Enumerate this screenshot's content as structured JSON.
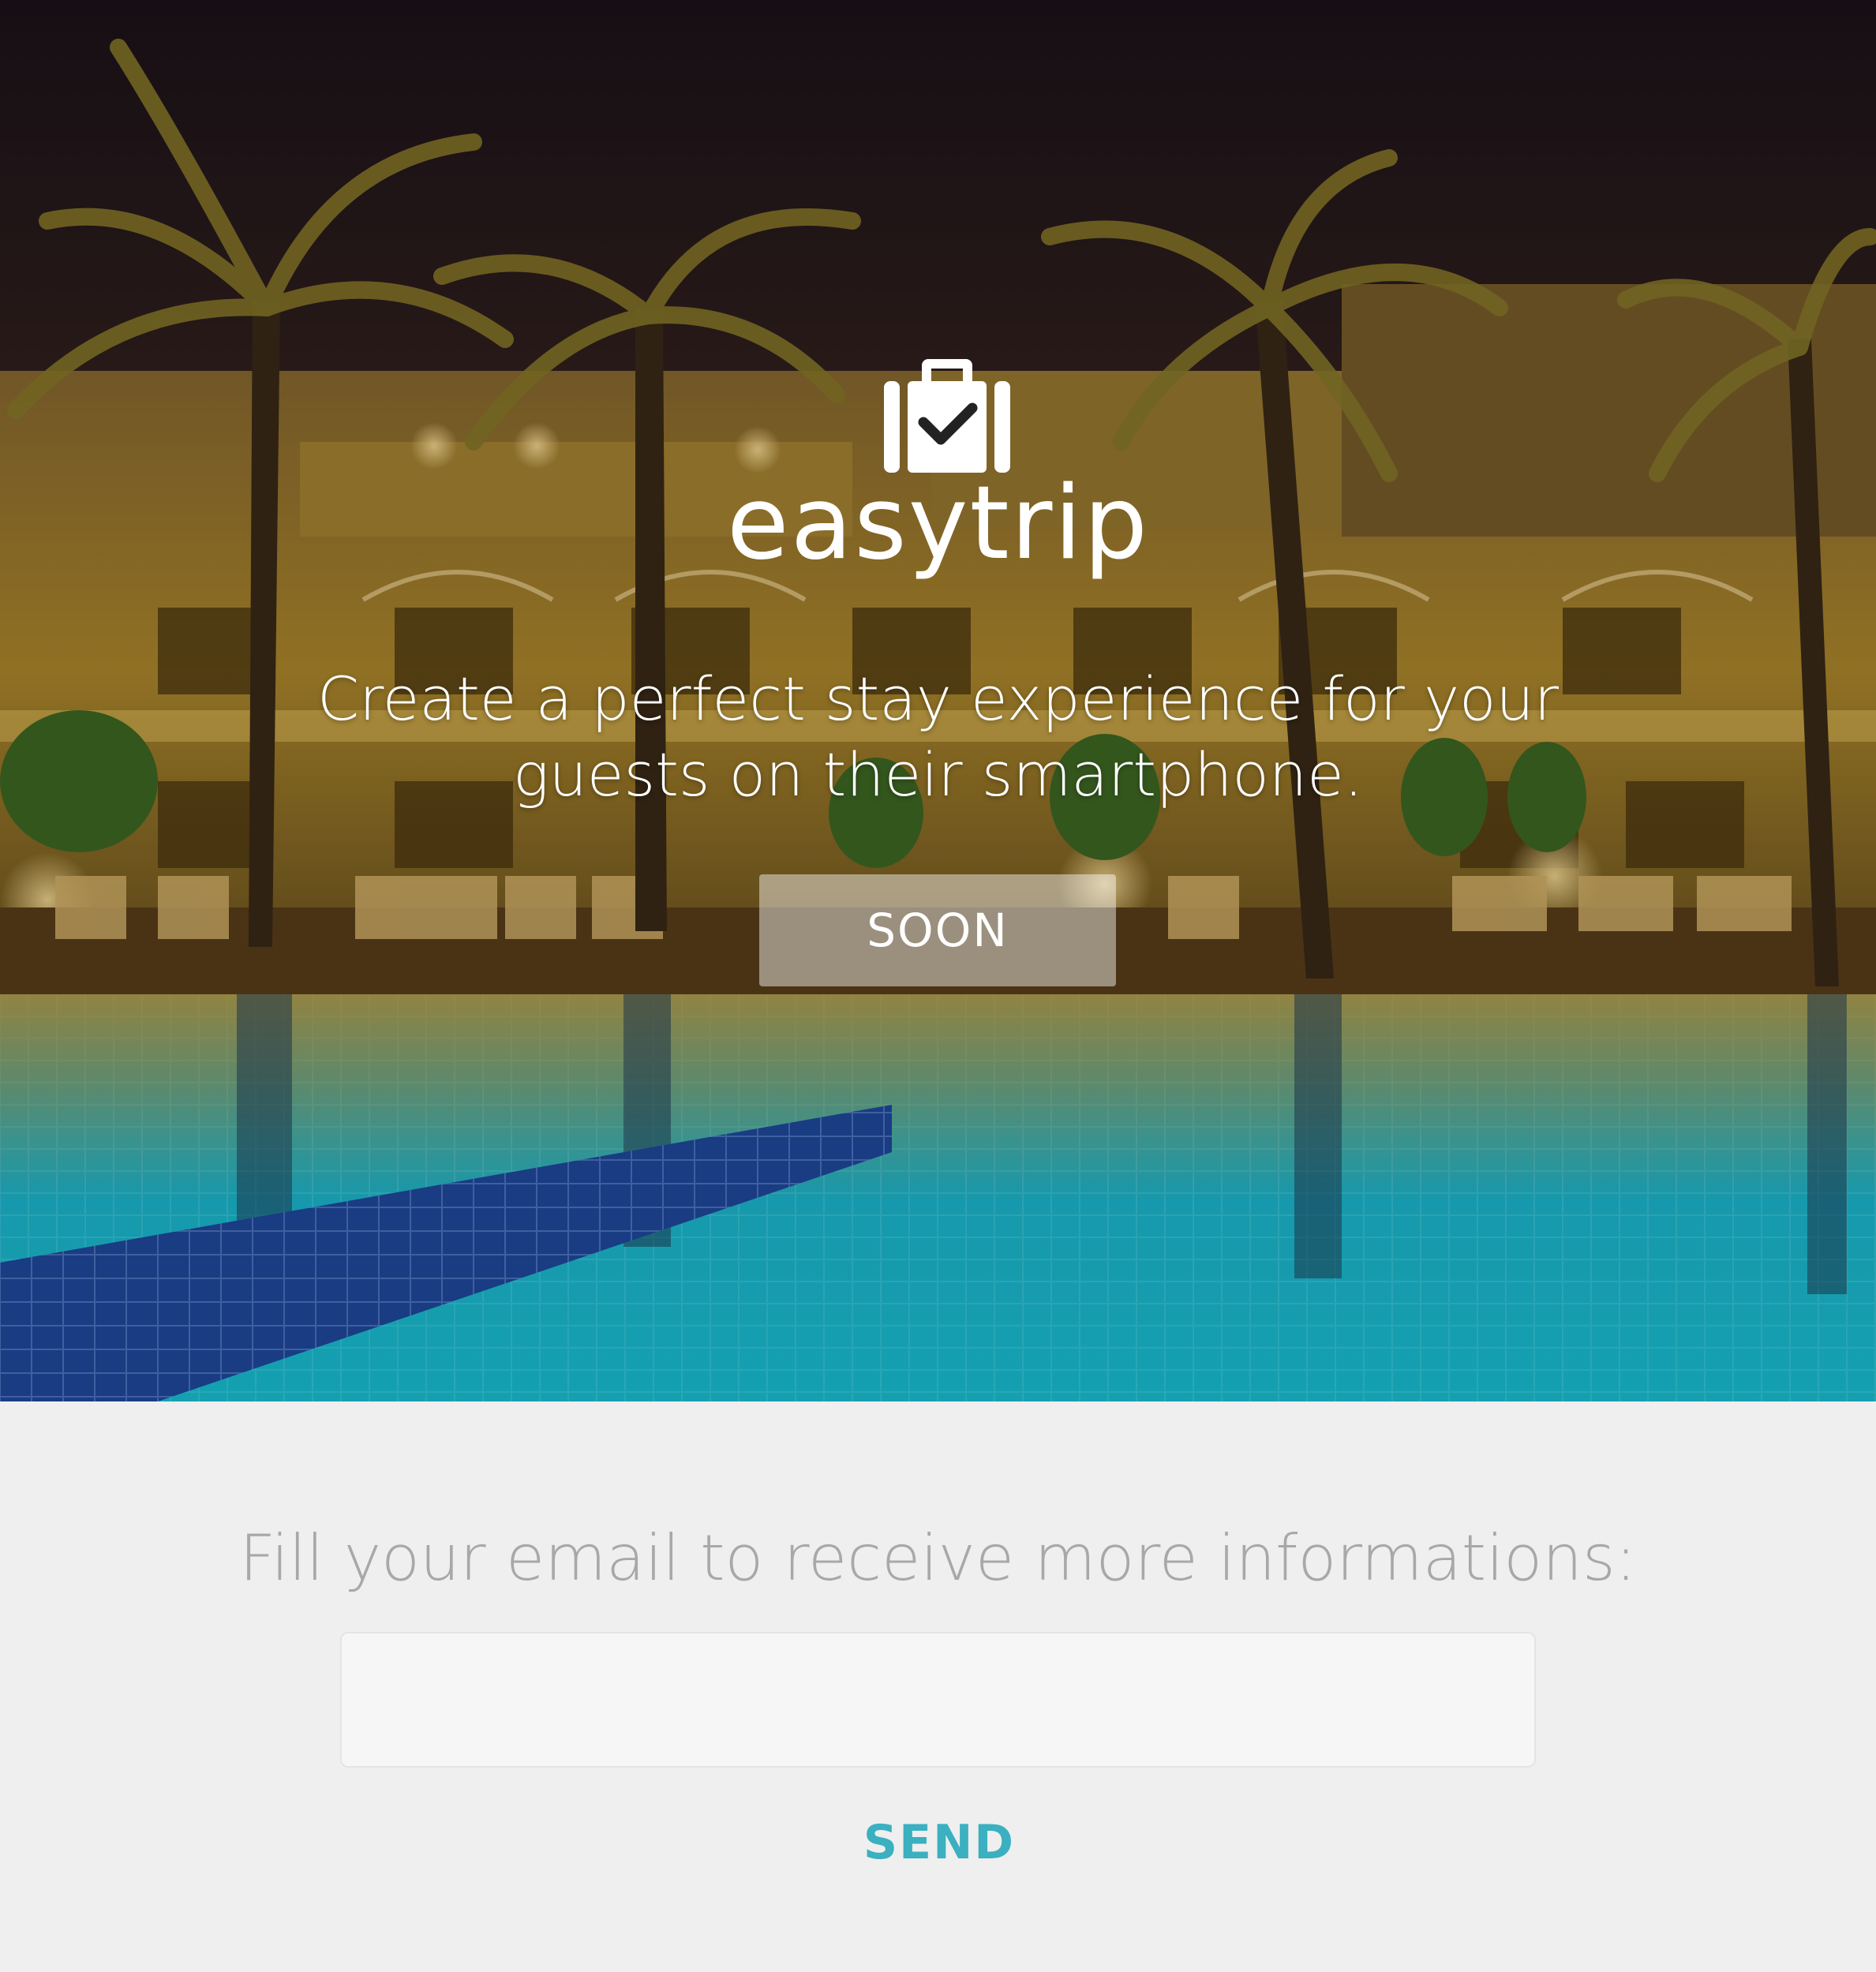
{
  "hero": {
    "brand_name": "easytrip",
    "tagline_line1": "Create a perfect stay experience for your",
    "tagline_line2": "guests on their smartphone.",
    "soon_label": "SOON",
    "logo_icon": "suitcase-check-icon",
    "background": "night-resort-pool-photo"
  },
  "signup": {
    "prompt": "Fill your email to receive more informations:",
    "email_value": "",
    "email_placeholder": "",
    "send_label": "SEND"
  },
  "colors": {
    "accent": "#3ab0c0",
    "section_bg": "#efefef",
    "input_bg": "#f6f6f6",
    "prompt_text": "#a8a8a8"
  }
}
